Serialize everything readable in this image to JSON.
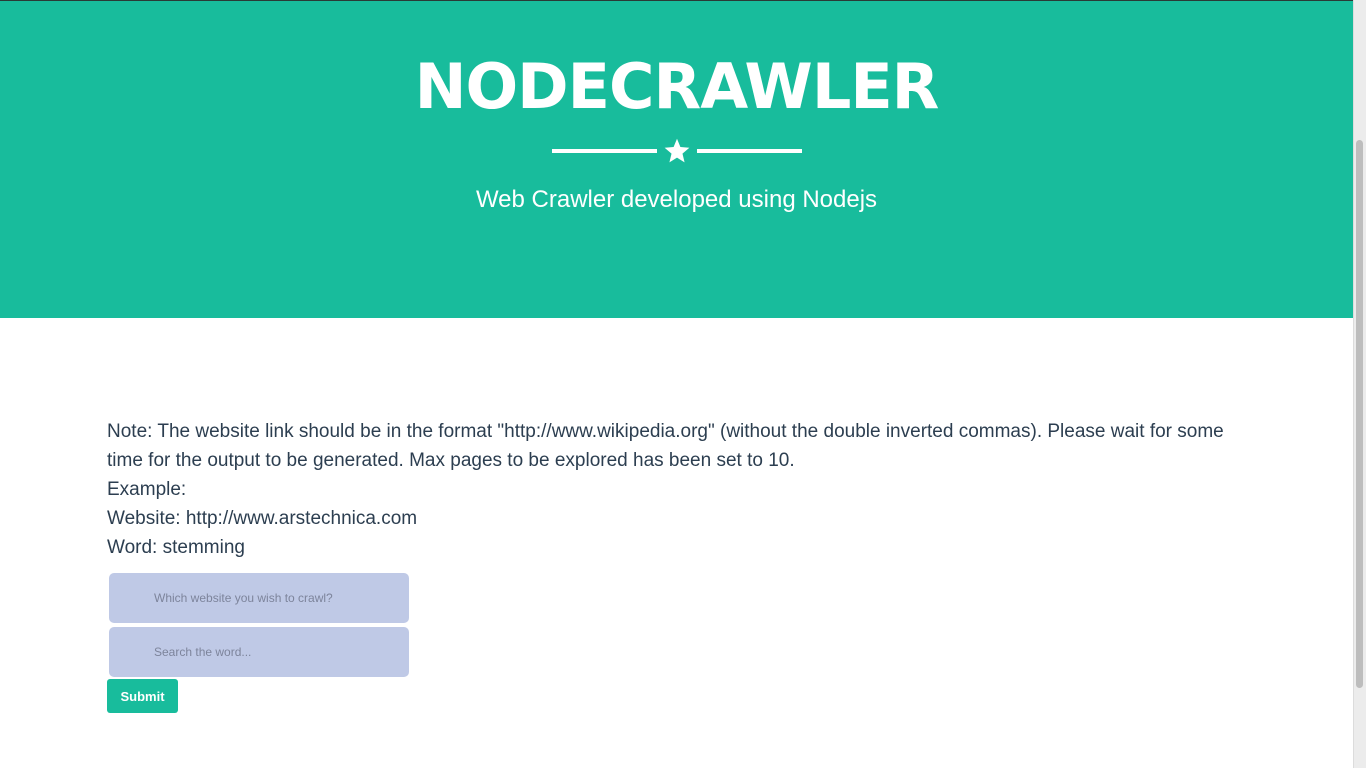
{
  "header": {
    "title": "NODECRAWLER",
    "subtitle": "Web Crawler developed using Nodejs",
    "divider_icon": "star-icon"
  },
  "content": {
    "note": "Note: The website link should be in the format \"http://www.wikipedia.org\" (without the double inverted commas). Please wait for some time for the output to be generated. Max pages to be explored has been set to 10.",
    "example_heading": "Example:",
    "example_website": "Website: http://www.arstechnica.com",
    "example_word": "Word: stemming"
  },
  "form": {
    "website_placeholder": "Which website you wish to crawl?",
    "website_value": "",
    "word_placeholder": "Search the word...",
    "word_value": "",
    "submit_label": "Submit"
  },
  "colors": {
    "accent": "#18bc9c",
    "input_bg": "#bfc9e6",
    "text": "#2c3e50"
  }
}
